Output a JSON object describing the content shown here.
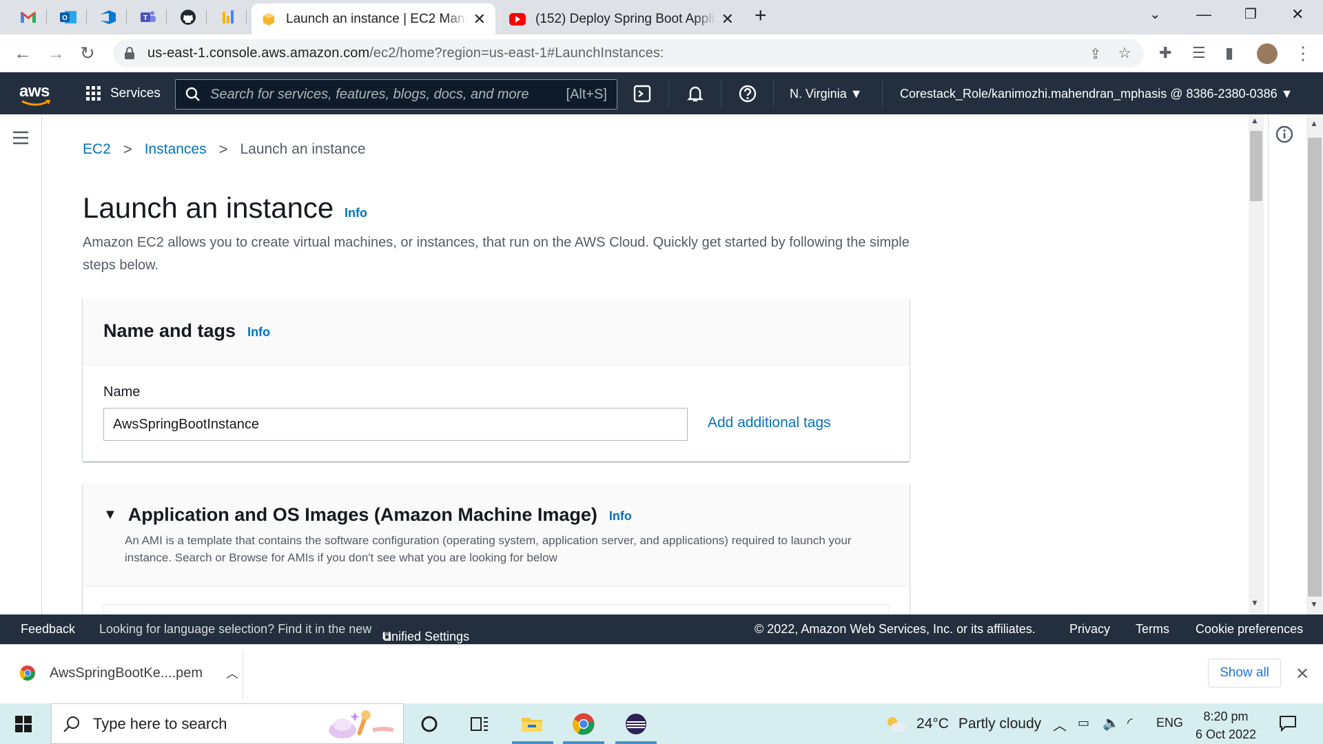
{
  "browser": {
    "tabs": [
      {
        "title": "Launch an instance | EC2 Management Console",
        "active": true
      },
      {
        "title": "(152) Deploy Spring Boot Application on AWS",
        "active": false
      }
    ],
    "url_host": "us-east-1.console.aws.amazon.com",
    "url_rest": "/ec2/home?region=us-east-1#LaunchInstances:"
  },
  "aws_nav": {
    "logo": "aws",
    "services": "Services",
    "search_placeholder": "Search for services, features, blogs, docs, and more",
    "search_shortcut": "[Alt+S]",
    "region": "N. Virginia",
    "account": "Corestack_Role/kanimozhi.mahendran_mphasis @ 8386-2380-0386"
  },
  "breadcrumb": {
    "ec2": "EC2",
    "instances": "Instances",
    "current": "Launch an instance"
  },
  "page": {
    "title": "Launch an instance",
    "info": "Info",
    "description": "Amazon EC2 allows you to create virtual machines, or instances, that run on the AWS Cloud. Quickly get started by following the simple steps below."
  },
  "name_tags": {
    "title": "Name and tags",
    "info": "Info",
    "name_label": "Name",
    "name_value": "AwsSpringBootInstance",
    "add_tags": "Add additional tags"
  },
  "ami": {
    "title": "Application and OS Images (Amazon Machine Image)",
    "info": "Info",
    "description": "An AMI is a template that contains the software configuration (operating system, application server, and applications) required to launch your instance. Search or Browse for AMIs if you don't see what you are looking for below"
  },
  "footer": {
    "feedback": "Feedback",
    "lang_text": "Looking for language selection? Find it in the new",
    "unified": "Unified Settings",
    "copyright": "© 2022, Amazon Web Services, Inc. or its affiliates.",
    "privacy": "Privacy",
    "terms": "Terms",
    "cookies": "Cookie preferences"
  },
  "download": {
    "file": "AwsSpringBootKe....pem",
    "show_all": "Show all"
  },
  "taskbar": {
    "search_placeholder": "Type here to search",
    "temp": "24°C",
    "weather": "Partly cloudy",
    "lang": "ENG",
    "time": "8:20 pm",
    "date": "6 Oct 2022"
  }
}
